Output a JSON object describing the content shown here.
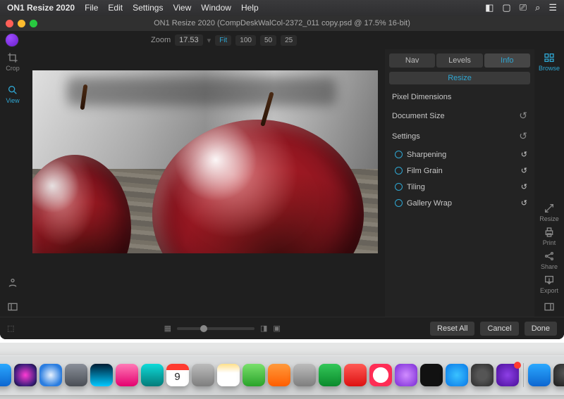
{
  "menubar": {
    "app_name": "ON1 Resize 2020",
    "items": [
      "File",
      "Edit",
      "Settings",
      "View",
      "Window",
      "Help"
    ],
    "right_icons": [
      "notification-icon",
      "airplay-icon",
      "display-icon",
      "search-icon",
      "control-center-icon"
    ]
  },
  "window": {
    "title": "ON1 Resize 2020 (CompDeskWalCol-2372_011 copy.psd @ 17.5% 16-bit)"
  },
  "zoom": {
    "label": "Zoom",
    "value": "17.53",
    "fit": "Fit",
    "presets": [
      "100",
      "50",
      "25"
    ]
  },
  "left_tools": {
    "crop": "Crop",
    "view": "View",
    "info": "info-icon",
    "layout": "panel-toggle-icon"
  },
  "right_strip": {
    "browse": "Browse",
    "resize": "Resize",
    "print": "Print",
    "share": "Share",
    "export": "Export",
    "layout": "panel-toggle-icon"
  },
  "panel": {
    "tabs": {
      "nav": "Nav",
      "levels": "Levels",
      "info": "Info"
    },
    "resize_label": "Resize",
    "sections": {
      "pixel_dimensions": "Pixel Dimensions",
      "document_size": "Document Size",
      "settings": "Settings"
    },
    "subs": {
      "sharpening": "Sharpening",
      "film_grain": "Film Grain",
      "tiling": "Tiling",
      "gallery_wrap": "Gallery Wrap"
    },
    "reset_glyph": "↺"
  },
  "bottom": {
    "reset_all": "Reset All",
    "cancel": "Cancel",
    "done": "Done"
  },
  "dock": {
    "calendar_day": "9"
  }
}
